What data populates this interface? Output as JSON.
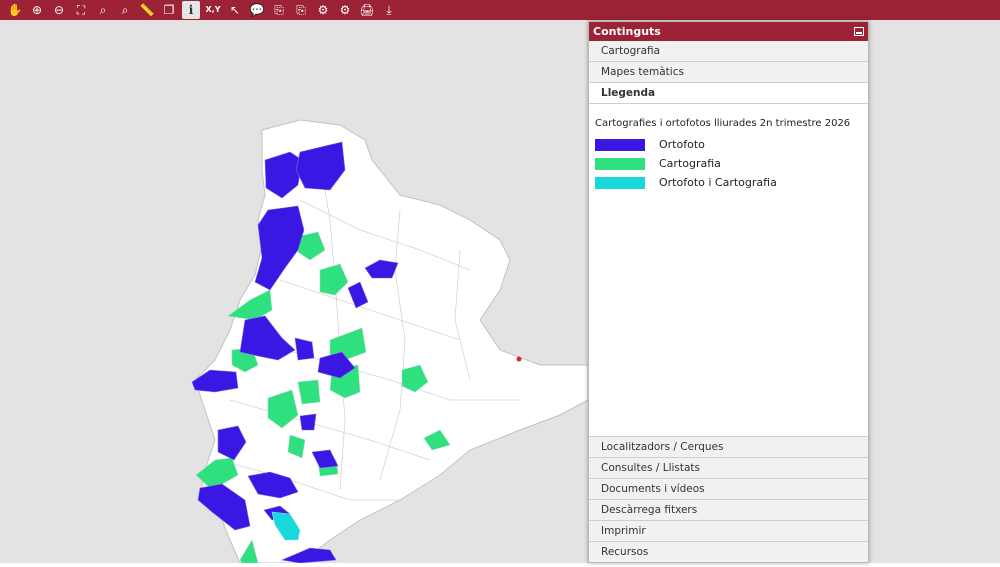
{
  "toolbar": {
    "tools": [
      {
        "name": "pan",
        "glyph": "✋"
      },
      {
        "name": "zoom-in",
        "glyph": "⊕"
      },
      {
        "name": "zoom-out",
        "glyph": "⊖"
      },
      {
        "name": "zoom-extent",
        "glyph": "⛶"
      },
      {
        "name": "zoom-previous",
        "glyph": "⌕"
      },
      {
        "name": "zoom-next",
        "glyph": "⌕"
      },
      {
        "name": "measure",
        "glyph": "📏"
      },
      {
        "name": "layers",
        "glyph": "❐"
      },
      {
        "name": "info",
        "glyph": "i"
      },
      {
        "name": "coordinates",
        "glyph": "X,Y"
      },
      {
        "name": "select-xy",
        "glyph": "↖"
      },
      {
        "name": "comment",
        "glyph": "💬"
      },
      {
        "name": "export",
        "glyph": "⎘"
      },
      {
        "name": "export-2",
        "glyph": "⎘"
      },
      {
        "name": "settings",
        "glyph": "⚙"
      },
      {
        "name": "settings-2",
        "glyph": "⚙"
      },
      {
        "name": "print",
        "glyph": "🖨"
      },
      {
        "name": "download",
        "glyph": "⤓"
      }
    ]
  },
  "panel": {
    "title": "Continguts",
    "sections_top": [
      "Cartografia",
      "Mapes temàtics"
    ],
    "open_section": "Llegenda",
    "legend": {
      "title": "Cartografies i ortofotos lliurades 2n trimestre 2026",
      "items": [
        {
          "label": "Ortofoto",
          "color": "#3b17e4"
        },
        {
          "label": "Cartografia",
          "color": "#2ee07e"
        },
        {
          "label": "Ortofoto i Cartografia",
          "color": "#19d8dc"
        }
      ]
    },
    "sections_bottom": [
      "Localitzadors / Cerques",
      "Consultes / Llistats",
      "Documents i vídeos",
      "Descàrrega fitxers",
      "Imprimir",
      "Recursos"
    ]
  },
  "map": {
    "colors": {
      "background": "#e3e3e3",
      "region": "#ffffff",
      "borders": "#c2c2c2",
      "marker": "#d42a2a"
    }
  }
}
